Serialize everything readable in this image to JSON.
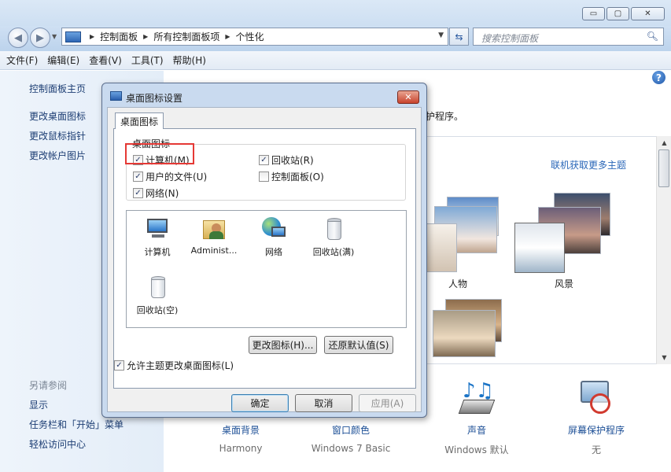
{
  "window": {
    "minimize_glyph": "▭",
    "maximize_glyph": "▢",
    "close_glyph": "✕"
  },
  "address": {
    "breadcrumbs": [
      "控制面板",
      "所有控制面板项",
      "个性化"
    ],
    "search_placeholder": "搜索控制面板"
  },
  "menu": [
    "文件(F)",
    "编辑(E)",
    "查看(V)",
    "工具(T)",
    "帮助(H)"
  ],
  "sidebar": {
    "home": "控制面板主页",
    "links": [
      "更改桌面图标",
      "更改鼠标指针",
      "更改帐户图片"
    ],
    "see_also_title": "另请参阅",
    "see_also": [
      "显示",
      "任务栏和「开始」菜单",
      "轻松访问中心"
    ]
  },
  "main": {
    "description_tail": "护程序。",
    "online_themes_link": "联机获取更多主题",
    "themes": [
      "人物",
      "风景"
    ],
    "bottom": [
      {
        "label": "桌面背景",
        "sub": "Harmony",
        "icon": "desktop-background-icon"
      },
      {
        "label": "窗口颜色",
        "sub": "Windows 7 Basic",
        "icon": "window-color-icon"
      },
      {
        "label": "声音",
        "sub": "Windows 默认",
        "icon": "music-notes-icon"
      },
      {
        "label": "屏幕保护程序",
        "sub": "无",
        "icon": "screensaver-icon"
      }
    ]
  },
  "dialog": {
    "title": "桌面图标设置",
    "tab": "桌面图标",
    "group_title": "桌面图标",
    "checkboxes": [
      {
        "label": "计算机(M)",
        "checked": true
      },
      {
        "label": "回收站(R)",
        "checked": true
      },
      {
        "label": "用户的文件(U)",
        "checked": true
      },
      {
        "label": "控制面板(O)",
        "checked": false
      },
      {
        "label": "网络(N)",
        "checked": true
      }
    ],
    "icons": [
      {
        "label": "计算机",
        "icon": "computer-icon"
      },
      {
        "label": "Administ...",
        "icon": "user-folder-icon"
      },
      {
        "label": "网络",
        "icon": "network-globe-icon"
      },
      {
        "label": "回收站(满)",
        "icon": "recycle-bin-full-icon"
      },
      {
        "label": "回收站(空)",
        "icon": "recycle-bin-empty-icon"
      }
    ],
    "change_icon_button": "更改图标(H)...",
    "restore_default_button": "还原默认值(S)",
    "allow_themes_checkbox": "允许主题更改桌面图标(L)",
    "allow_themes_checked": true,
    "ok_button": "确定",
    "cancel_button": "取消",
    "apply_button": "应用(A)"
  }
}
